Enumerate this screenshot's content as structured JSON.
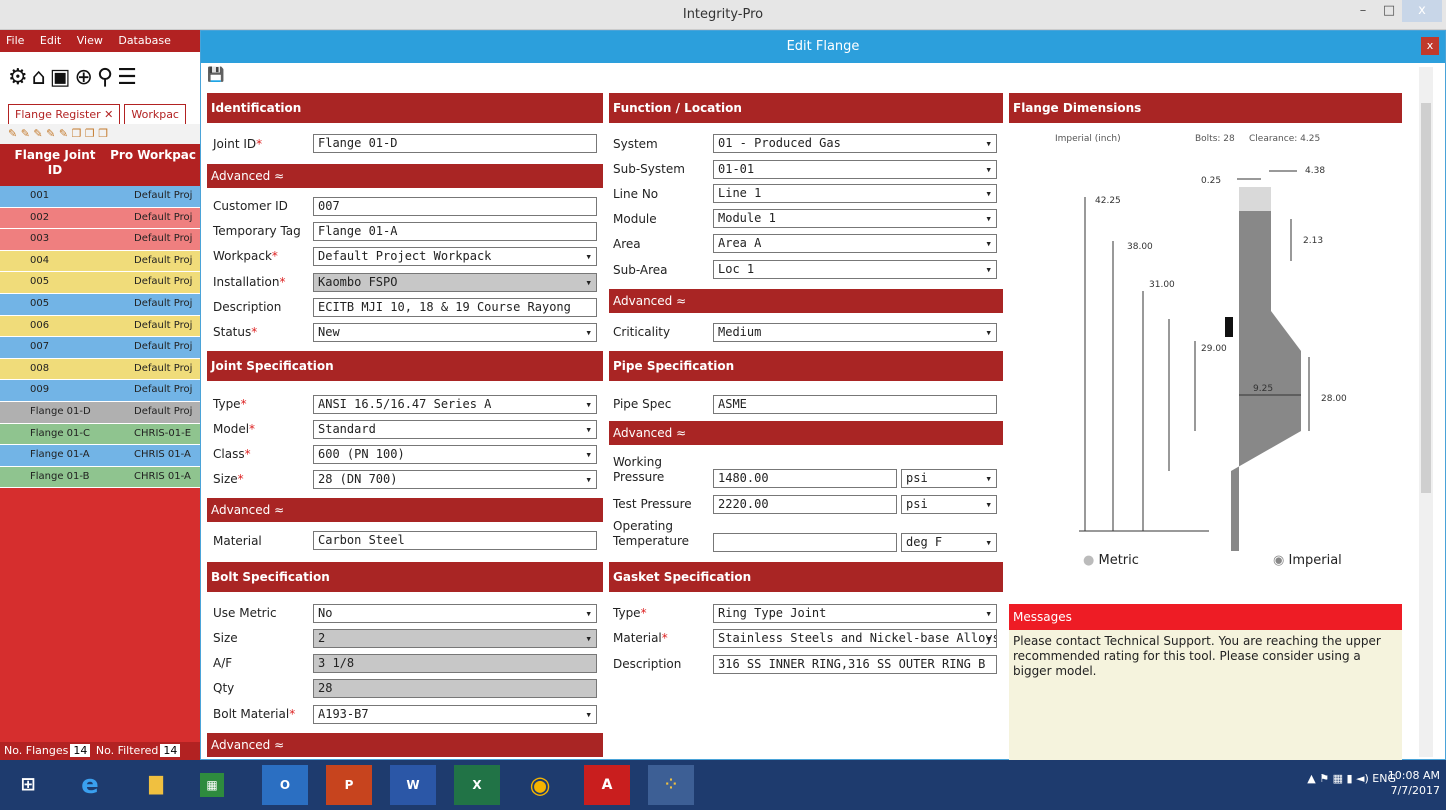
{
  "window": {
    "title": "Integrity-Pro",
    "min": "–",
    "max": "□",
    "close": "x"
  },
  "menu": [
    "File",
    "Edit",
    "View",
    "Database"
  ],
  "left": {
    "tabs": [
      "Flange Register",
      "Workpac"
    ],
    "tab_close": "✕",
    "col1": "Flange Joint ID",
    "col2": "Pro Workpac",
    "rows": [
      {
        "id": "001",
        "wp": "Default Proj",
        "color": "#72b4e6"
      },
      {
        "id": "002",
        "wp": "Default Proj",
        "color": "#ef7f7f"
      },
      {
        "id": "003",
        "wp": "Default Proj",
        "color": "#ef7f7f"
      },
      {
        "id": "004",
        "wp": "Default Proj",
        "color": "#f0dc7a"
      },
      {
        "id": "005",
        "wp": "Default Proj",
        "color": "#f0dc7a"
      },
      {
        "id": "005",
        "wp": "Default Proj",
        "color": "#72b4e6"
      },
      {
        "id": "006",
        "wp": "Default Proj",
        "color": "#f0dc7a"
      },
      {
        "id": "007",
        "wp": "Default Proj",
        "color": "#72b4e6"
      },
      {
        "id": "008",
        "wp": "Default Proj",
        "color": "#f0dc7a"
      },
      {
        "id": "009",
        "wp": "Default Proj",
        "color": "#72b4e6"
      },
      {
        "id": "Flange 01-D",
        "wp": "Default Proj",
        "color": "#b0b0b0"
      },
      {
        "id": "Flange 01-C",
        "wp": "CHRIS-01-E",
        "color": "#8fc48f"
      },
      {
        "id": "Flange 01-A",
        "wp": "CHRIS 01-A",
        "color": "#72b4e6"
      },
      {
        "id": "Flange 01-B",
        "wp": "CHRIS 01-A",
        "color": "#8fc48f"
      }
    ],
    "status_flanges": "No. Flanges",
    "status_flanges_val": "14",
    "status_filtered": "No. Filtered",
    "status_filtered_val": "14"
  },
  "dialog": {
    "title": "Edit Flange",
    "close": "x",
    "identification": {
      "header": "Identification",
      "joint_id_label": "Joint ID",
      "joint_id": "Flange 01-D",
      "advanced": "Advanced",
      "customer_id_label": "Customer ID",
      "customer_id": "007",
      "temp_tag_label": "Temporary Tag",
      "temp_tag": "Flange 01-A",
      "workpack_label": "Workpack",
      "workpack": "Default Project Workpack",
      "installation_label": "Installation",
      "installation": "Kaombo FSPO",
      "description_label": "Description",
      "description": "ECITB MJI 10, 18 & 19 Course Rayong",
      "status_label": "Status",
      "status": "New"
    },
    "joint_spec": {
      "header": "Joint Specification",
      "type_label": "Type",
      "type": "ANSI 16.5/16.47 Series A",
      "model_label": "Model",
      "model": "Standard",
      "class_label": "Class",
      "class": "600 (PN 100)",
      "size_label": "Size",
      "size": "28 (DN 700)",
      "advanced": "Advanced",
      "material_label": "Material",
      "material": "Carbon Steel"
    },
    "bolt_spec": {
      "header": "Bolt Specification",
      "use_metric_label": "Use Metric",
      "use_metric": "No",
      "size_label": "Size",
      "size": "2",
      "af_label": "A/F",
      "af": "3 1/8",
      "qty_label": "Qty",
      "qty": "28",
      "bolt_material_label": "Bolt Material",
      "bolt_material": "A193-B7",
      "advanced": "Advanced"
    },
    "function": {
      "header": "Function / Location",
      "system_label": "System",
      "system": "01 - Produced Gas",
      "subsystem_label": "Sub-System",
      "subsystem": "01-01",
      "lineno_label": "Line No",
      "lineno": "Line 1",
      "module_label": "Module",
      "module": "Module 1",
      "area_label": "Area",
      "area": "Area A",
      "subarea_label": "Sub-Area",
      "subarea": "Loc 1",
      "advanced": "Advanced",
      "criticality_label": "Criticality",
      "criticality": "Medium"
    },
    "pipe_spec": {
      "header": "Pipe Specification",
      "pipe_spec_label": "Pipe Spec",
      "pipe_spec": "ASME",
      "advanced": "Advanced",
      "wp_label1": "Working",
      "wp_label2": "Pressure",
      "wp": "1480.00",
      "wp_unit": "psi",
      "tp_label": "Test Pressure",
      "tp": "2220.00",
      "tp_unit": "psi",
      "ot_label1": "Operating",
      "ot_label2": "Temperature",
      "ot": "",
      "ot_unit": "deg F"
    },
    "gasket_spec": {
      "header": "Gasket Specification",
      "type_label": "Type",
      "type": "Ring Type Joint",
      "material_label": "Material",
      "material": "Stainless Steels and Nickel-base Alloys",
      "description_label": "Description",
      "description": "316 SS INNER RING,316 SS OUTER RING B"
    },
    "dimensions": {
      "header": "Flange Dimensions",
      "units": "Imperial (inch)",
      "bolts": "Bolts: 28",
      "clearance": "Clearance: 4.25",
      "d_025": "0.25",
      "d_438": "4.38",
      "d_4225": "42.25",
      "d_213": "2.13",
      "d_3800": "38.00",
      "d_3100": "31.00",
      "d_2900": "29.00",
      "d_925": "9.25",
      "d_2800": "28.00",
      "metric": "Metric",
      "imperial": "Imperial"
    },
    "messages": {
      "header": "Messages",
      "text": "Please contact Technical Support. You are reaching the upper recommended rating for this tool. Please consider using a bigger model."
    }
  },
  "taskbar": {
    "lang": "ENG",
    "time": "10:08 AM",
    "date": "7/7/2017"
  }
}
